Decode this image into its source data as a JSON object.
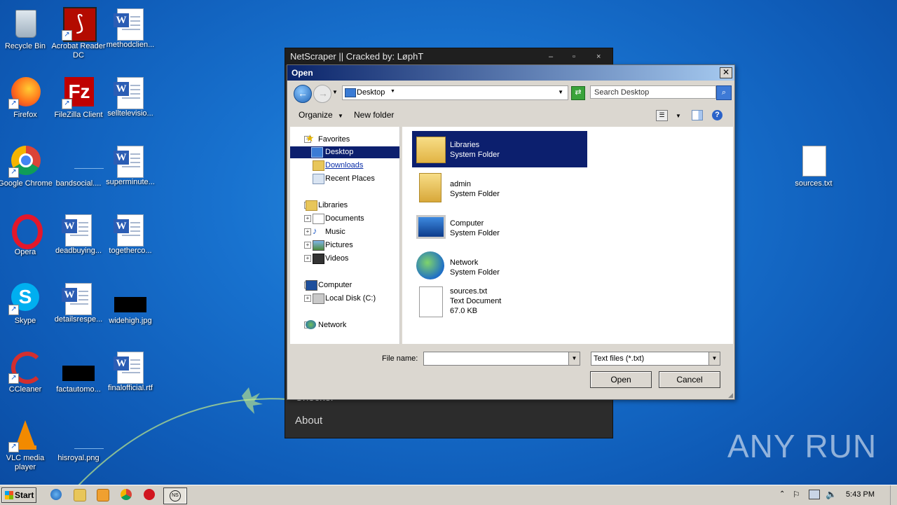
{
  "desktop": {
    "icons": [
      {
        "label": "Recycle Bin"
      },
      {
        "label": "Acrobat Reader DC"
      },
      {
        "label": "methodclien..."
      },
      {
        "label": "Firefox"
      },
      {
        "label": "FileZilla Client"
      },
      {
        "label": "selltelevisio..."
      },
      {
        "label": "Google Chrome"
      },
      {
        "label": "bandsocial...."
      },
      {
        "label": "superminute..."
      },
      {
        "label": "Opera"
      },
      {
        "label": "deadbuying..."
      },
      {
        "label": "togetherco..."
      },
      {
        "label": "Skype"
      },
      {
        "label": "detailsrespe..."
      },
      {
        "label": "widehigh.jpg"
      },
      {
        "label": "CCleaner"
      },
      {
        "label": "factautomo..."
      },
      {
        "label": "finalofficial.rtf"
      },
      {
        "label": "VLC media player"
      },
      {
        "label": "hisroyal.png"
      },
      {
        "label": "sources.txt"
      }
    ]
  },
  "netscraper": {
    "title": "NetScraper || Cracked by: LøphT",
    "menu": [
      "Checker",
      "About"
    ]
  },
  "dialog": {
    "title": "Open",
    "address": "Desktop",
    "search_placeholder": "Search Desktop",
    "toolbar": {
      "organize": "Organize",
      "new_folder": "New folder"
    },
    "tree": {
      "favorites": "Favorites",
      "desktop": "Desktop",
      "downloads": "Downloads",
      "recent": "Recent Places",
      "libraries": "Libraries",
      "documents": "Documents",
      "music": "Music",
      "pictures": "Pictures",
      "videos": "Videos",
      "computer": "Computer",
      "localdisk": "Local Disk (C:)",
      "network": "Network"
    },
    "files": [
      {
        "name": "Libraries",
        "type": "System Folder",
        "size": ""
      },
      {
        "name": "admin",
        "type": "System Folder",
        "size": ""
      },
      {
        "name": "Computer",
        "type": "System Folder",
        "size": ""
      },
      {
        "name": "Network",
        "type": "System Folder",
        "size": ""
      },
      {
        "name": "sources.txt",
        "type": "Text Document",
        "size": "67.0 KB"
      }
    ],
    "filename_label": "File name:",
    "filename_value": "",
    "filter": "Text files (*.txt)",
    "open": "Open",
    "cancel": "Cancel"
  },
  "taskbar": {
    "start": "Start",
    "time": "5:43 PM"
  },
  "watermark": "ANY RUN"
}
